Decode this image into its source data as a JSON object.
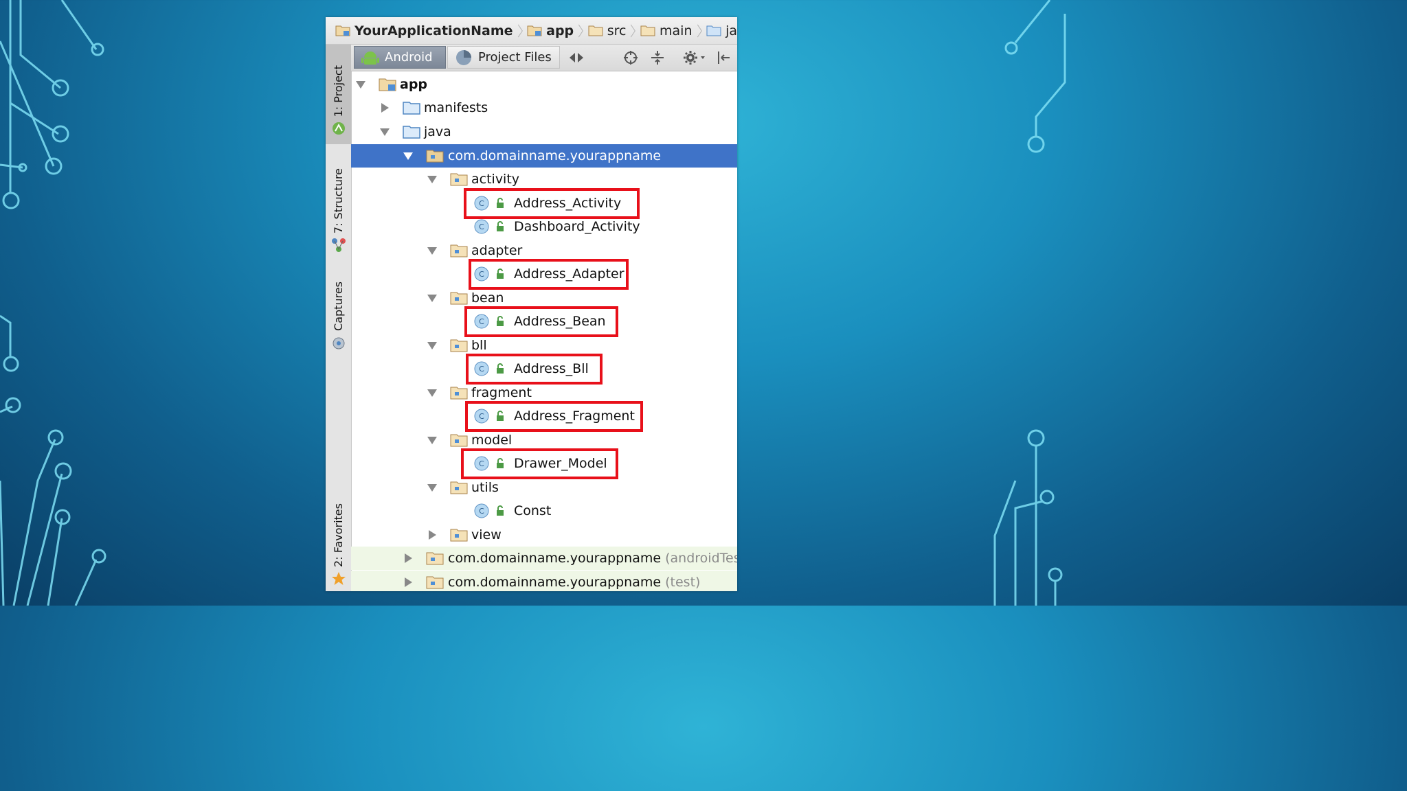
{
  "navbar": {
    "crumbs": [
      "YourApplicationName",
      "app",
      "src",
      "main",
      "ja"
    ]
  },
  "sidebar": {
    "tabs": [
      "1: Project",
      "7: Structure",
      "Captures",
      "2: Favorites"
    ]
  },
  "toolbar": {
    "tab_android": "Android",
    "tab_project_files": "Project Files"
  },
  "tree": {
    "root": "app",
    "manifests": "manifests",
    "java": "java",
    "package": "com.domainname.yourappname",
    "activity": "activity",
    "address_activity": "Address_Activity",
    "dashboard_activity": "Dashboard_Activity",
    "adapter": "adapter",
    "address_adapter": "Address_Adapter",
    "bean": "bean",
    "address_bean": "Address_Bean",
    "bll": "bll",
    "address_bll": "Address_Bll",
    "fragment": "fragment",
    "address_fragment": "Address_Fragment",
    "model": "model",
    "drawer_model": "Drawer_Model",
    "utils": "utils",
    "const": "Const",
    "view": "view",
    "package_android_test": "com.domainname.yourappname",
    "android_test_suffix": "(androidTest",
    "package_test": "com.domainname.yourappname",
    "test_suffix": "(test)"
  },
  "colors": {
    "selection": "#3f73c8",
    "highlight_box": "#e8101a",
    "test_row_tint": "#eff7e6"
  }
}
